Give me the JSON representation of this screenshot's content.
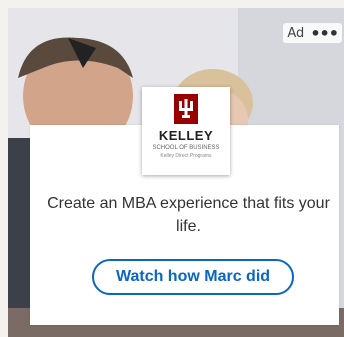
{
  "ad": {
    "label": "Ad",
    "more_icon": "more-horizontal-icon",
    "brand": {
      "name": "KELLEY",
      "subtitle": "SCHOOL OF BUSINESS",
      "program": "Kelley Direct Programs",
      "logo_icon": "iu-trident-icon",
      "brand_color": "#990000"
    },
    "headline": "Create an MBA experience that fits your life.",
    "cta_label": "Watch how Marc did",
    "accent_color": "#0a66c2"
  }
}
